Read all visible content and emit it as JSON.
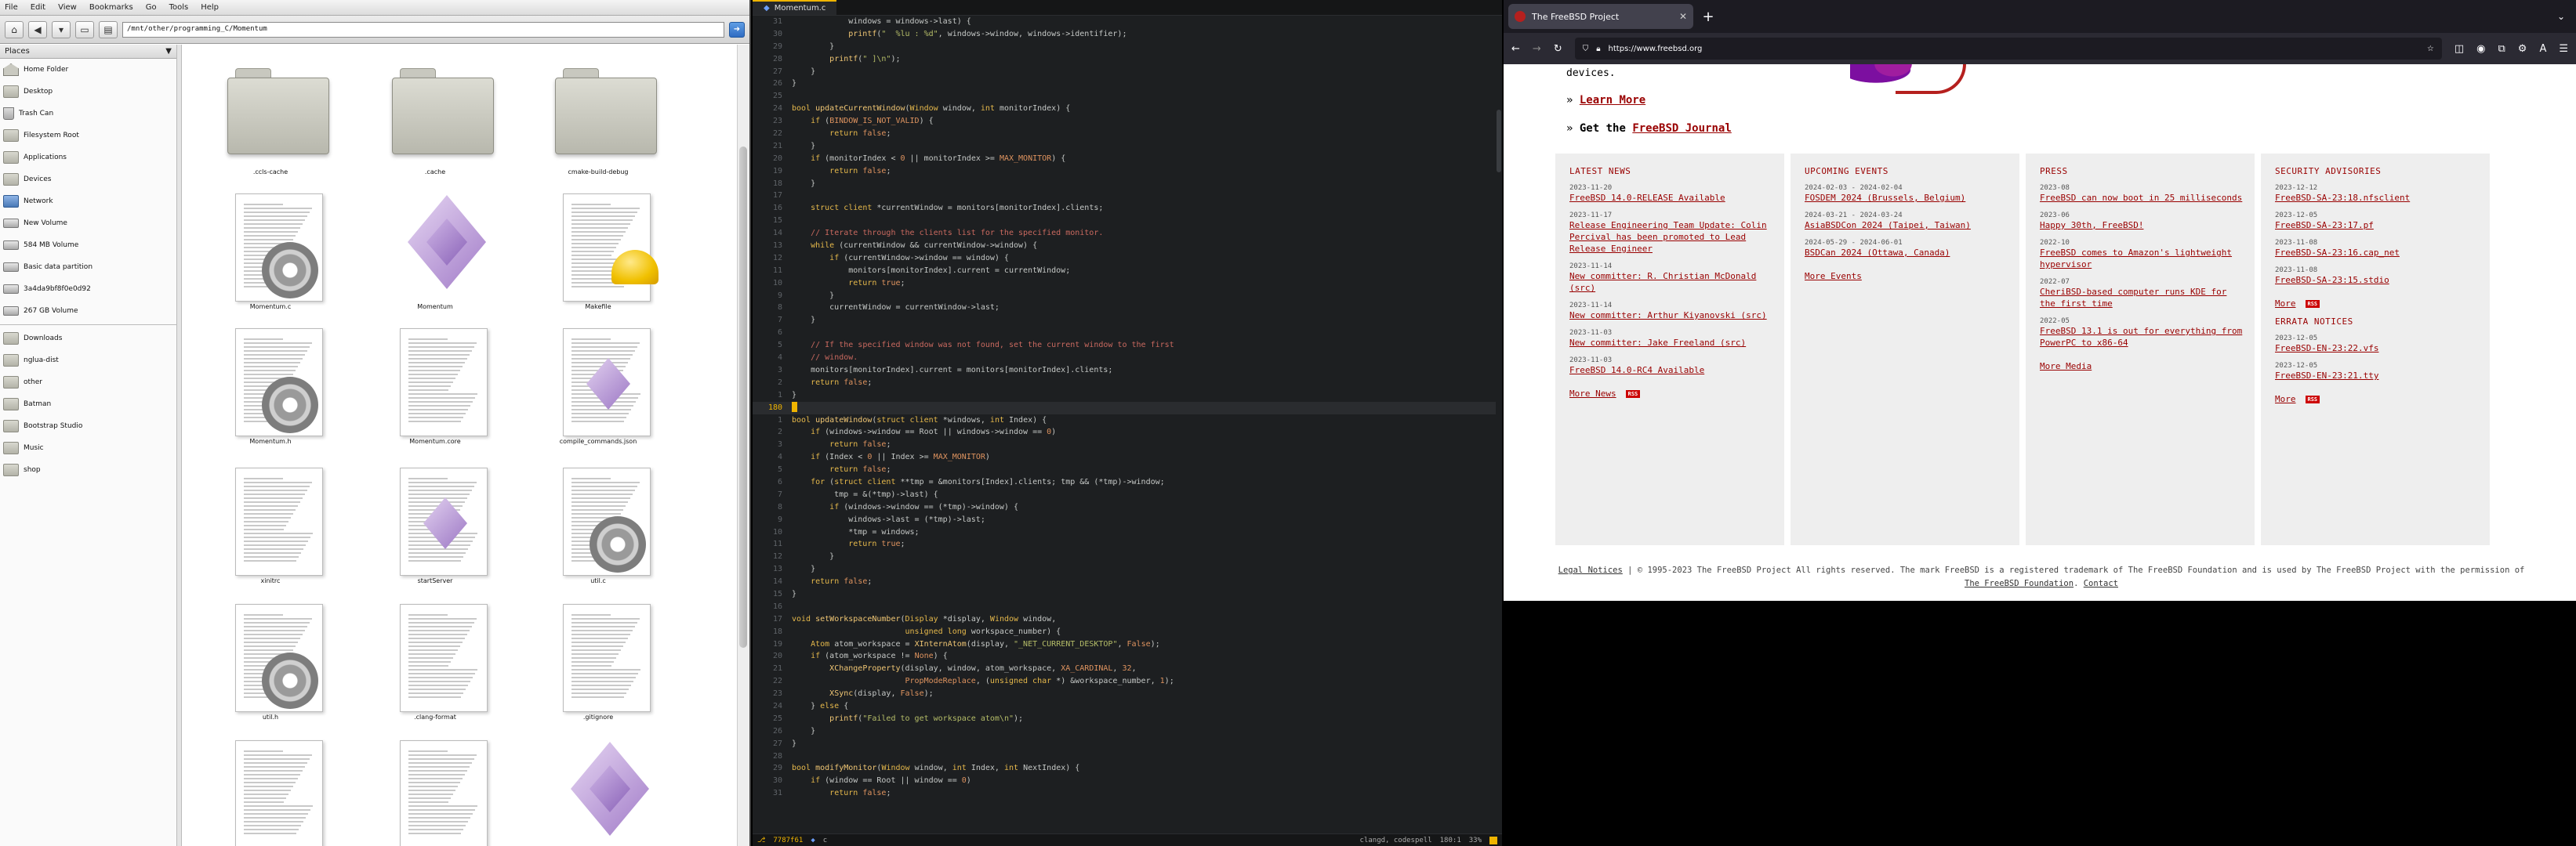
{
  "file_manager": {
    "menu": [
      "File",
      "Edit",
      "View",
      "Bookmarks",
      "Go",
      "Tools",
      "Help"
    ],
    "path": "/mnt/other/programming_C/Momentum",
    "places_title": "Places",
    "places": [
      {
        "label": "Home Folder",
        "icon": "home-icon",
        "kind": "home"
      },
      {
        "label": "Desktop",
        "icon": "folder-icon",
        "kind": "folder"
      },
      {
        "label": "Trash Can",
        "icon": "trash-icon",
        "kind": "trash"
      },
      {
        "label": "Filesystem Root",
        "icon": "folder-icon",
        "kind": "folder"
      },
      {
        "label": "Applications",
        "icon": "folder-icon",
        "kind": "folder"
      },
      {
        "label": "Devices",
        "icon": "folder-icon",
        "kind": "folder"
      },
      {
        "label": "Network",
        "icon": "network-icon",
        "kind": "net"
      },
      {
        "label": "New Volume",
        "icon": "drive-icon",
        "kind": "drive"
      },
      {
        "label": "584 MB Volume",
        "icon": "drive-icon",
        "kind": "drive"
      },
      {
        "label": "Basic data partition",
        "icon": "drive-icon",
        "kind": "drive"
      },
      {
        "label": "3a4da9bf8f0e0d92",
        "icon": "drive-icon",
        "kind": "drive"
      },
      {
        "label": "267 GB Volume",
        "icon": "drive-icon",
        "kind": "drive"
      }
    ],
    "bookmarks": [
      {
        "label": "Downloads"
      },
      {
        "label": "nglua-dist"
      },
      {
        "label": "other"
      },
      {
        "label": "Batman"
      },
      {
        "label": "Bootstrap Studio"
      },
      {
        "label": "Music"
      },
      {
        "label": "shop"
      }
    ],
    "files": [
      {
        "name": ".ccls-cache",
        "type": "folder"
      },
      {
        "name": ".cache",
        "type": "folder"
      },
      {
        "name": "cmake-build-debug",
        "type": "folder"
      },
      {
        "name": "Momentum.c",
        "type": "c"
      },
      {
        "name": "Momentum",
        "type": "exec"
      },
      {
        "name": "Makefile",
        "type": "make"
      },
      {
        "name": "Momentum.h",
        "type": "c"
      },
      {
        "name": "Momentum.core",
        "type": "text"
      },
      {
        "name": "compile_commands.json",
        "type": "textexec"
      },
      {
        "name": "xinitrc",
        "type": "text"
      },
      {
        "name": "startServer",
        "type": "textexec"
      },
      {
        "name": "util.c",
        "type": "c"
      },
      {
        "name": "util.h",
        "type": "c"
      },
      {
        "name": ".clang-format",
        "type": "text"
      },
      {
        "name": ".gitignore",
        "type": "text"
      },
      {
        "name": "",
        "type": "text"
      },
      {
        "name": "",
        "type": "text"
      },
      {
        "name": "",
        "type": "exec"
      }
    ]
  },
  "editor": {
    "tab_title": "Momentum.c",
    "lines": [
      {
        "no": "31",
        "html": "            windows = windows-&gt;<span class=\"n\">last</span>) {"
      },
      {
        "no": "30",
        "html": "            <span class=\"f\">printf</span>(<span class=\"s\">\"  %lu : %d\"</span>, windows-&gt;window, windows-&gt;identifier);"
      },
      {
        "no": "29",
        "html": "        }"
      },
      {
        "no": "28",
        "html": "        <span class=\"f\">printf</span>(<span class=\"s\">\" ]\\n\"</span>);"
      },
      {
        "no": "27",
        "html": "    }"
      },
      {
        "no": "26",
        "html": "}"
      },
      {
        "no": "25",
        "html": ""
      },
      {
        "no": "24",
        "html": "<span class=\"t\">bool</span> <span class=\"f\">updateCurrentWindow</span>(<span class=\"t\">Window</span> window, <span class=\"t\">int</span> monitorIndex) {"
      },
      {
        "no": "23",
        "html": "    <span class=\"k\">if</span> (<span class=\"m\">BINDOW_IS_NOT_VALID</span>) {"
      },
      {
        "no": "22",
        "html": "        <span class=\"k\">return</span> <span class=\"m\">false</span>;"
      },
      {
        "no": "21",
        "html": "    }"
      },
      {
        "no": "20",
        "html": "    <span class=\"k\">if</span> (monitorIndex &lt; <span class=\"m\">0</span> || monitorIndex &gt;= <span class=\"m\">MAX_MONITOR</span>) {"
      },
      {
        "no": "19",
        "html": "        <span class=\"k\">return</span> <span class=\"m\">false</span>;"
      },
      {
        "no": "18",
        "html": "    }"
      },
      {
        "no": "17",
        "html": ""
      },
      {
        "no": "16",
        "html": "    <span class=\"t\">struct client</span> *currentWindow = monitors[monitorIndex].clients;"
      },
      {
        "no": "15",
        "html": ""
      },
      {
        "no": "14",
        "html": "    <span class=\"c\">// Iterate through the clients list for the specified monitor.</span>"
      },
      {
        "no": "13",
        "html": "    <span class=\"k\">while</span> (currentWindow &amp;&amp; currentWindow-&gt;window) {"
      },
      {
        "no": "12",
        "html": "        <span class=\"k\">if</span> (currentWindow-&gt;window == window) {"
      },
      {
        "no": "11",
        "html": "            monitors[monitorIndex].current = currentWindow;"
      },
      {
        "no": "10",
        "html": "            <span class=\"k\">return</span> <span class=\"m\">true</span>;"
      },
      {
        "no": "9",
        "html": "        }"
      },
      {
        "no": "8",
        "html": "        currentWindow = currentWindow-&gt;last;"
      },
      {
        "no": "7",
        "html": "    }"
      },
      {
        "no": "6",
        "html": ""
      },
      {
        "no": "5",
        "html": "    <span class=\"c\">// If the specified window was not found, set the current window to the first</span>"
      },
      {
        "no": "4",
        "html": "    <span class=\"c\">// window.</span>"
      },
      {
        "no": "3",
        "html": "    monitors[monitorIndex].current = monitors[monitorIndex].clients;"
      },
      {
        "no": "2",
        "html": "    <span class=\"k\">return</span> <span class=\"m\">false</span>;"
      },
      {
        "no": "1",
        "html": "}"
      },
      {
        "no": "180",
        "html": "<span class=\"cur-box\"></span>",
        "cur": true
      },
      {
        "no": "1",
        "html": "<span class=\"t\">bool</span> <span class=\"f\">updateWindow</span>(<span class=\"t\">struct client</span> *windows, <span class=\"t\">int</span> Index) {"
      },
      {
        "no": "2",
        "html": "    <span class=\"k\">if</span> (windows-&gt;window == Root || windows-&gt;window == <span class=\"m\">0</span>)"
      },
      {
        "no": "3",
        "html": "        <span class=\"k\">return</span> <span class=\"m\">false</span>;"
      },
      {
        "no": "4",
        "html": "    <span class=\"k\">if</span> (Index &lt; <span class=\"m\">0</span> || Index &gt;= <span class=\"m\">MAX_MONITOR</span>)"
      },
      {
        "no": "5",
        "html": "        <span class=\"k\">return</span> <span class=\"m\">false</span>;"
      },
      {
        "no": "6",
        "html": "    <span class=\"k\">for</span> (<span class=\"t\">struct client</span> **tmp = &amp;monitors[Index].clients; tmp &amp;&amp; (*tmp)-&gt;window;"
      },
      {
        "no": "7",
        "html": "         tmp = &amp;(*tmp)-&gt;last) {"
      },
      {
        "no": "8",
        "html": "        <span class=\"k\">if</span> (windows-&gt;window == (*tmp)-&gt;window) {"
      },
      {
        "no": "9",
        "html": "            windows-&gt;last = (*tmp)-&gt;last;"
      },
      {
        "no": "10",
        "html": "            *tmp = windows;"
      },
      {
        "no": "11",
        "html": "            <span class=\"k\">return</span> <span class=\"m\">true</span>;"
      },
      {
        "no": "12",
        "html": "        }"
      },
      {
        "no": "13",
        "html": "    }"
      },
      {
        "no": "14",
        "html": "    <span class=\"k\">return</span> <span class=\"m\">false</span>;"
      },
      {
        "no": "15",
        "html": "}"
      },
      {
        "no": "16",
        "html": ""
      },
      {
        "no": "17",
        "html": "<span class=\"t\">void</span> <span class=\"f\">setWorkspaceNumber</span>(<span class=\"t\">Display</span> *display, <span class=\"t\">Window</span> window,"
      },
      {
        "no": "18",
        "html": "                        <span class=\"t\">unsigned long</span> workspace_number) {"
      },
      {
        "no": "19",
        "html": "    <span class=\"t\">Atom</span> atom_workspace = <span class=\"f\">XInternAtom</span>(display, <span class=\"s\">\"_NET_CURRENT_DESKTOP\"</span>, <span class=\"m\">False</span>);"
      },
      {
        "no": "20",
        "html": "    <span class=\"k\">if</span> (atom_workspace != <span class=\"m\">None</span>) {"
      },
      {
        "no": "21",
        "html": "        <span class=\"f\">XChangeProperty</span>(display, window, atom_workspace, <span class=\"m\">XA_CARDINAL</span>, <span class=\"m\">32</span>,"
      },
      {
        "no": "22",
        "html": "                        <span class=\"m\">PropModeReplace</span>, (<span class=\"t\">unsigned char</span> *) &amp;workspace_number, <span class=\"m\">1</span>);"
      },
      {
        "no": "23",
        "html": "        <span class=\"f\">XSync</span>(display, <span class=\"m\">False</span>);"
      },
      {
        "no": "24",
        "html": "    } <span class=\"k\">else</span> {"
      },
      {
        "no": "25",
        "html": "        <span class=\"f\">printf</span>(<span class=\"s\">\"Failed to get workspace atom\\n\"</span>);"
      },
      {
        "no": "26",
        "html": "    }"
      },
      {
        "no": "27",
        "html": "}"
      },
      {
        "no": "28",
        "html": ""
      },
      {
        "no": "29",
        "html": "<span class=\"t\">bool</span> <span class=\"f\">modifyMonitor</span>(<span class=\"t\">Window</span> window, <span class=\"t\">int</span> Index, <span class=\"t\">int</span> NextIndex) {"
      },
      {
        "no": "30",
        "html": "    <span class=\"k\">if</span> (window == Root || window == <span class=\"m\">0</span>)"
      },
      {
        "no": "31",
        "html": "        <span class=\"k\">return</span> <span class=\"m\">false</span>;"
      }
    ],
    "status_left": "7787f61",
    "status_lang": "c",
    "status_right": "clangd, codespell",
    "status_pos": "180:1",
    "status_pct": "33%"
  },
  "browser": {
    "tab_title": "The FreeBSD Project",
    "url": "https://www.freebsd.org",
    "top_fragment": "devices.",
    "learn_more": "Learn More",
    "get_the": "Get the",
    "journal": "FreeBSD Journal",
    "columns": [
      {
        "title": "LATEST NEWS",
        "entries": [
          {
            "date": "2023-11-20",
            "text": "FreeBSD 14.0-RELEASE Available"
          },
          {
            "date": "2023-11-17",
            "text": "Release Engineering Team Update: Colin Percival has been promoted to Lead Release Engineer"
          },
          {
            "date": "2023-11-14",
            "text": "New committer: R. Christian McDonald (src)"
          },
          {
            "date": "2023-11-14",
            "text": "New committer: Arthur Kiyanovski (src)"
          },
          {
            "date": "2023-11-03",
            "text": "New committer: Jake Freeland (src)"
          },
          {
            "date": "2023-11-03",
            "text": "FreeBSD 14.0-RC4 Available"
          }
        ],
        "more": "More News",
        "rss": true
      },
      {
        "title": "UPCOMING EVENTS",
        "entries": [
          {
            "date": "2024-02-03 - 2024-02-04",
            "text": "FOSDEM 2024 (Brussels, Belgium)"
          },
          {
            "date": "2024-03-21 - 2024-03-24",
            "text": "AsiaBSDCon 2024 (Taipei, Taiwan)"
          },
          {
            "date": "2024-05-29 - 2024-06-01",
            "text": "BSDCan 2024 (Ottawa, Canada)"
          }
        ],
        "more": "More Events",
        "rss": false
      },
      {
        "title": "PRESS",
        "entries": [
          {
            "date": "2023-08",
            "text": "FreeBSD can now boot in 25 milliseconds"
          },
          {
            "date": "2023-06",
            "text": "Happy 30th, FreeBSD!"
          },
          {
            "date": "2022-10",
            "text": "FreeBSD comes to Amazon's lightweight hypervisor"
          },
          {
            "date": "2022-07",
            "text": "CheriBSD-based computer runs KDE for the first time"
          },
          {
            "date": "2022-05",
            "text": "FreeBSD 13.1 is out for everything from PowerPC to x86-64"
          }
        ],
        "more": "More Media",
        "rss": false
      },
      {
        "title": "SECURITY ADVISORIES",
        "entries": [
          {
            "date": "2023-12-12",
            "text": "FreeBSD-SA-23:18.nfsclient"
          },
          {
            "date": "2023-12-05",
            "text": "FreeBSD-SA-23:17.pf"
          },
          {
            "date": "2023-11-08",
            "text": "FreeBSD-SA-23:16.cap_net"
          },
          {
            "date": "2023-11-08",
            "text": "FreeBSD-SA-23:15.stdio"
          }
        ],
        "more": "More",
        "rss": true,
        "subtitle": "ERRATA NOTICES",
        "sub_entries": [
          {
            "date": "2023-12-05",
            "text": "FreeBSD-EN-23:22.vfs"
          },
          {
            "date": "2023-12-05",
            "text": "FreeBSD-EN-23:21.tty"
          }
        ],
        "sub_more": "More",
        "sub_rss": true
      }
    ],
    "rss_label": "RSS",
    "footer_legal": "Legal Notices",
    "footer_text": "| © 1995-2023 The FreeBSD Project All rights reserved. The mark FreeBSD is a registered trademark of The FreeBSD Foundation and is used by The FreeBSD Project with the permission of",
    "footer_foundation": "The FreeBSD Foundation",
    "footer_contact": "Contact"
  }
}
